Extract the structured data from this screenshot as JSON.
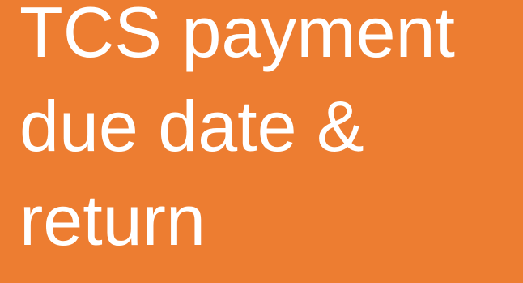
{
  "slide": {
    "background_color": "#ED7D31",
    "text_color": "#FFFFFF",
    "title_lines": [
      "TCS payment",
      "due date &",
      "return"
    ]
  }
}
